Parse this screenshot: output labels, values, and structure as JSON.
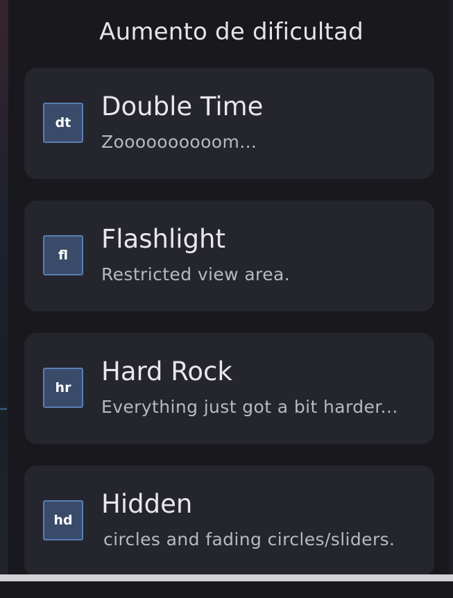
{
  "section": {
    "title": "Aumento de dificultad"
  },
  "mods": [
    {
      "acronym": "dt",
      "name": "Double Time",
      "description": "Zoooooooooom..."
    },
    {
      "acronym": "fl",
      "name": "Flashlight",
      "description": "Restricted view area."
    },
    {
      "acronym": "hr",
      "name": "Hard Rock",
      "description": "Everything just got a bit harder..."
    },
    {
      "acronym": "hd",
      "name": "Hidden",
      "description": "circles and fading circles/sliders."
    }
  ],
  "colors": {
    "background": "#18181d",
    "card": "#25252e",
    "icon_fill": "#3a4b6a",
    "icon_border": "#5a7fb3"
  }
}
